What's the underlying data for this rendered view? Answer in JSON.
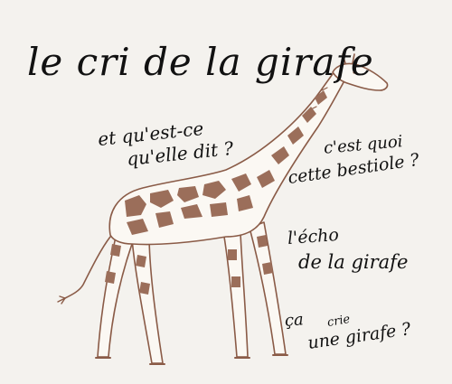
{
  "illustration": {
    "subject": "giraffe",
    "colors": {
      "background": "#f4f2ee",
      "spots": "#9b6e5a",
      "outline": "#8a5b47",
      "body": "#fbf8f3",
      "ink": "#111111"
    }
  },
  "title": "le cri de la girafe",
  "speech": {
    "q1": {
      "line1": "et qu'est-ce",
      "line2": "qu'elle dit ?"
    },
    "q2": {
      "line1": "c'est quoi",
      "line2": "cette bestiole ?"
    },
    "q3": {
      "line1": "l'écho",
      "line2": "de la girafe"
    },
    "q4": {
      "line1": "ça",
      "line2": "crie",
      "line3": "une girafe ?"
    }
  }
}
